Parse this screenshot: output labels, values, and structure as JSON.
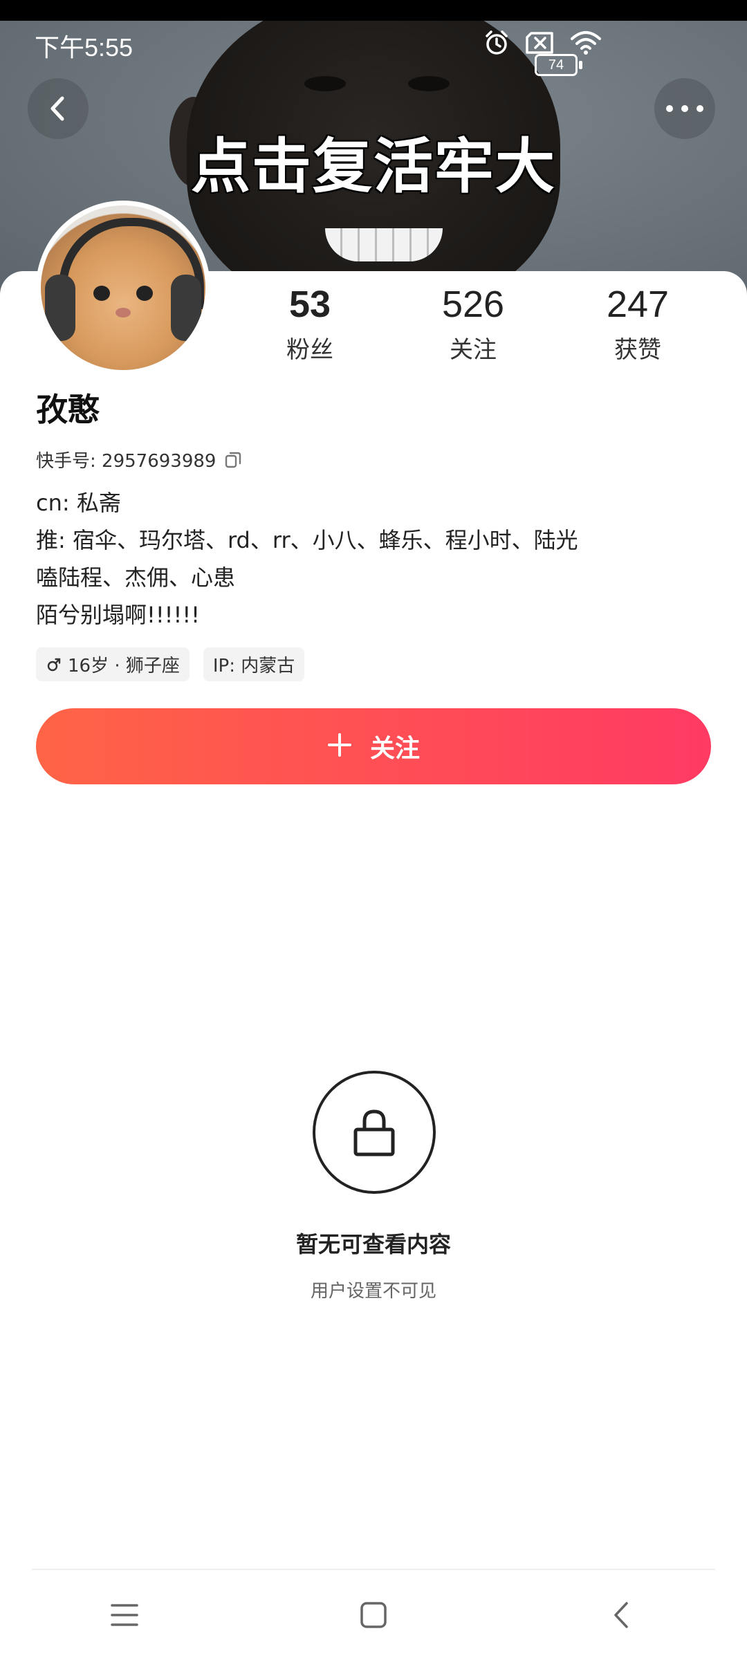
{
  "status_bar": {
    "time": "下午5:55",
    "battery": "74",
    "icons": [
      "alarm-icon",
      "no-sim-icon",
      "wifi-icon",
      "battery-icon"
    ]
  },
  "banner": {
    "caption": "点击复活牢大"
  },
  "header_actions": {
    "back_icon": "chevron-left-icon",
    "more_icon": "more-dots-icon"
  },
  "profile": {
    "stats": [
      {
        "value": "53",
        "label": "粉丝"
      },
      {
        "value": "526",
        "label": "关注"
      },
      {
        "value": "247",
        "label": "获赞"
      }
    ],
    "nickname": "孜憨",
    "uid_label": "快手号: 2957693989",
    "bio": [
      "cn: 私斋",
      "推: 宿伞、玛尔塔、rd、rr、小八、蜂乐、程小时、陆光",
      "嗑陆程、杰佣、心患",
      "陌兮别塌啊!!!!!!"
    ],
    "tags": [
      {
        "icon": "male-icon",
        "text": "16岁 · 狮子座"
      },
      {
        "text": "IP: 内蒙古"
      }
    ],
    "follow_button": "关注"
  },
  "empty_state": {
    "icon": "lock-icon",
    "title": "暂无可查看内容",
    "subtitle": "用户设置不可见"
  },
  "nav_bar": {
    "icons": [
      "menu-icon",
      "home-icon",
      "back-icon"
    ]
  },
  "colors": {
    "follow_gradient_start": "#ff6446",
    "follow_gradient_end": "#ff3a63"
  }
}
